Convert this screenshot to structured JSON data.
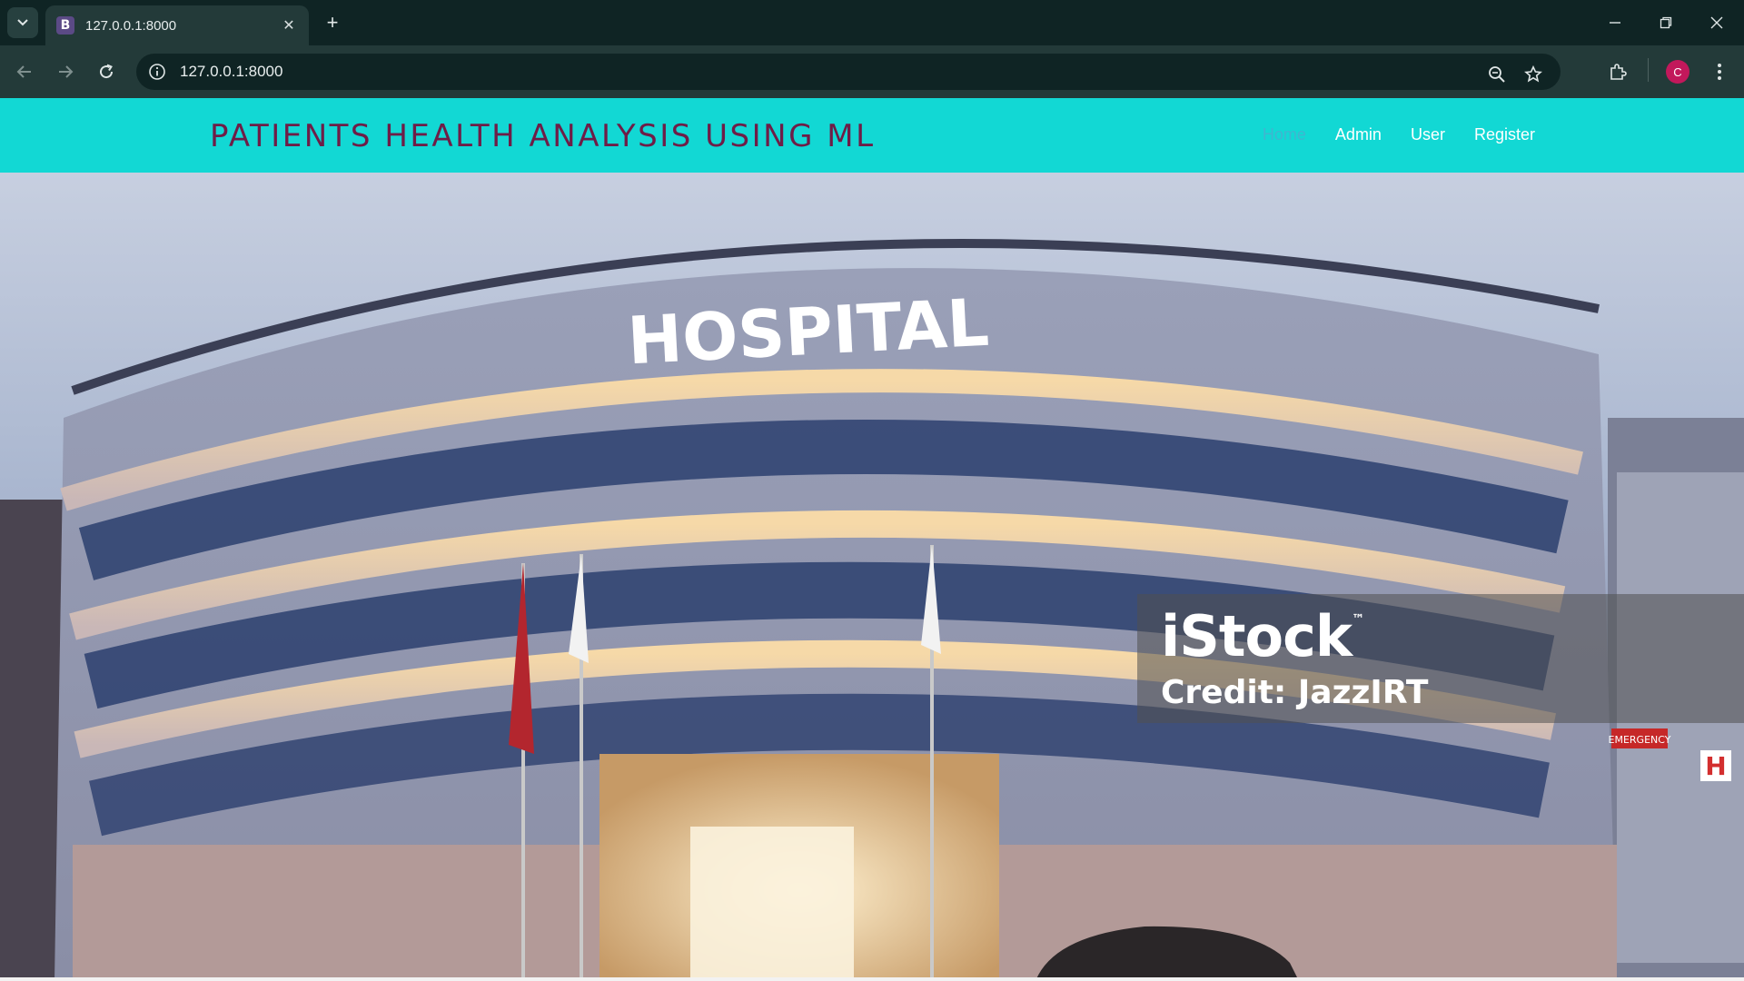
{
  "browser": {
    "tab_title": "127.0.0.1:8000",
    "tab_favicon_letter": "B",
    "url": "127.0.0.1:8000",
    "profile_initial": "C",
    "icons": [
      "tab-search-icon",
      "close-icon",
      "new-tab-icon",
      "minimize-icon",
      "restore-icon",
      "window-close-icon",
      "back-icon",
      "forward-icon",
      "reload-icon",
      "site-info-icon",
      "zoom-icon",
      "bookmark-star-icon",
      "extensions-icon",
      "menu-dots-icon"
    ]
  },
  "site": {
    "brand": "PATIENTS HEALTH ANALYSIS USING ML",
    "nav": [
      {
        "label": "Home",
        "active": true
      },
      {
        "label": "Admin",
        "active": false
      },
      {
        "label": "User",
        "active": false
      },
      {
        "label": "Register",
        "active": false
      }
    ],
    "colors": {
      "navbar": "#12d8d4",
      "brand_text": "#6e1d47",
      "nav_link": "#ffffff",
      "nav_active": "#3fb6d0"
    }
  },
  "hero": {
    "building_sign": "HOSPITAL",
    "emergency_sign": "EMERGENCY",
    "h_sign": "H",
    "watermark_logo": "iStock",
    "watermark_tm": "™",
    "watermark_credit": "Credit: JazzIRT"
  }
}
